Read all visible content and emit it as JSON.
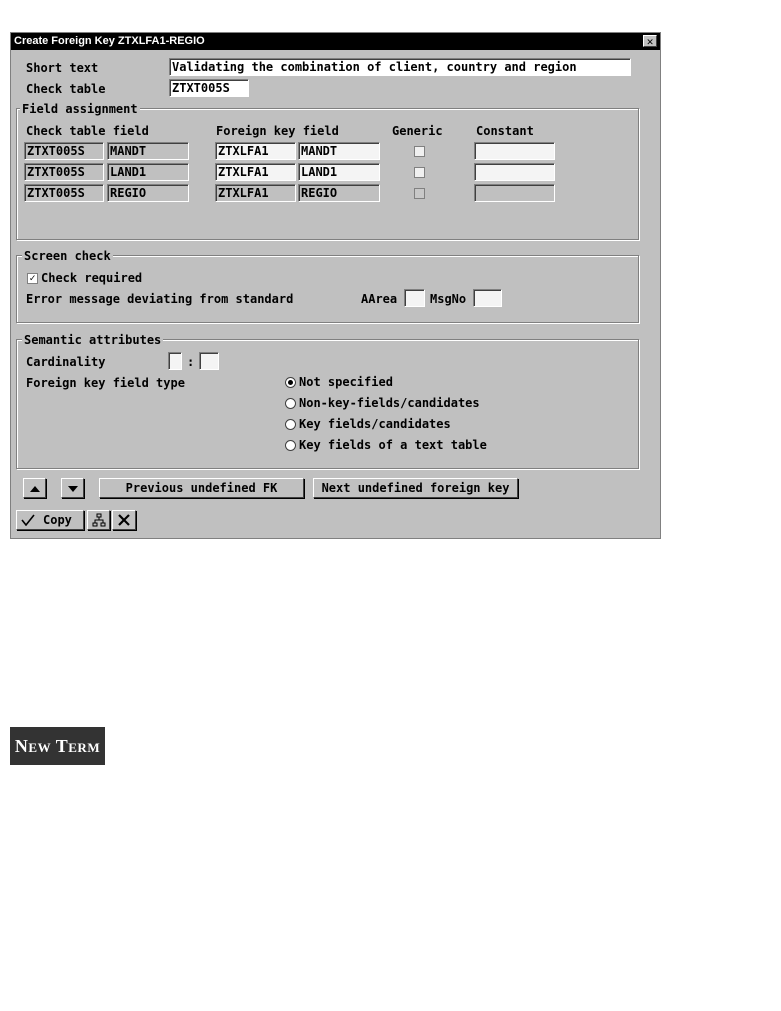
{
  "dialog": {
    "title": "Create Foreign Key ZTXLFA1-REGIO",
    "close_glyph": "✕"
  },
  "header": {
    "short_text_label": "Short text",
    "short_text_value": "Validating the combination of client, country and region",
    "check_table_label": "Check table",
    "check_table_value": "ZTXT005S"
  },
  "field_assignment": {
    "title": "Field assignment",
    "columns": {
      "check_table_field": "Check table field",
      "foreign_key_field": "Foreign key field",
      "generic": "Generic",
      "constant": "Constant"
    },
    "rows": [
      {
        "check_table": "ZTXT005S",
        "check_field": "MANDT",
        "fk_table": "ZTXLFA1",
        "fk_field": "MANDT",
        "generic": false,
        "constant": ""
      },
      {
        "check_table": "ZTXT005S",
        "check_field": "LAND1",
        "fk_table": "ZTXLFA1",
        "fk_field": "LAND1",
        "generic": false,
        "constant": ""
      },
      {
        "check_table": "ZTXT005S",
        "check_field": "REGIO",
        "fk_table": "ZTXLFA1",
        "fk_field": "REGIO",
        "generic": false,
        "constant": ""
      }
    ]
  },
  "screen_check": {
    "title": "Screen check",
    "check_required_label": "Check required",
    "check_required": true,
    "error_msg_label": "Error message deviating from standard",
    "aarea_label": "AArea",
    "aarea_value": "",
    "msgno_label": "MsgNo",
    "msgno_value": ""
  },
  "semantic": {
    "title": "Semantic attributes",
    "cardinality_label": "Cardinality",
    "cardinality_left": "",
    "cardinality_sep": ":",
    "cardinality_right": "",
    "fk_field_type_label": "Foreign key field type",
    "options": [
      {
        "label": "Not specified",
        "selected": true
      },
      {
        "label": "Non-key-fields/candidates",
        "selected": false
      },
      {
        "label": "Key fields/candidates",
        "selected": false
      },
      {
        "label": "Key fields of a text table",
        "selected": false
      }
    ]
  },
  "nav": {
    "prev_label": "Previous undefined FK",
    "next_label": "Next undefined foreign key"
  },
  "footer": {
    "copy_label": "Copy",
    "icons": [
      "check-icon",
      "hierarchy-icon",
      "cancel-icon"
    ]
  },
  "badge": {
    "label": "New Term"
  }
}
